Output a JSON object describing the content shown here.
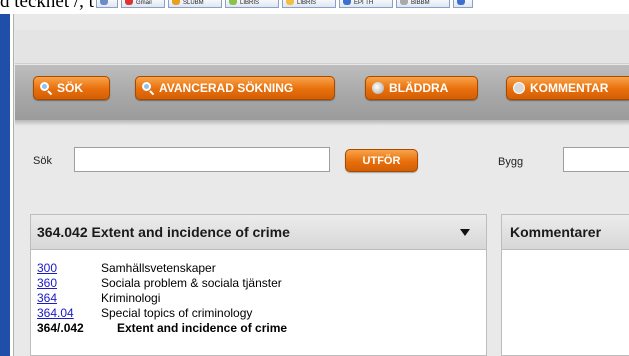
{
  "top_strip": {
    "cut_text": "d tecknet /, t ex",
    "taskbar_items": [
      {
        "label": "",
        "color": "#6b8cc7"
      },
      {
        "label": "Gmail",
        "color": "#d33"
      },
      {
        "label": "SLUBM",
        "color": "#e8a020"
      },
      {
        "label": "LIBRIS",
        "color": "#8bc34a"
      },
      {
        "label": "LIBRIS",
        "color": "#f0c040"
      },
      {
        "label": "EPI TH",
        "color": "#3b6fd0"
      },
      {
        "label": "BIBBM",
        "color": "#aaaaaa"
      },
      {
        "label": "",
        "color": "#3b6fd0"
      }
    ]
  },
  "nav": {
    "buttons": [
      {
        "label": "SÖK",
        "icon": "magnifier-icon"
      },
      {
        "label": "AVANCERAD SÖKNING",
        "icon": "magnifier-icon"
      },
      {
        "label": "BLÄDDRA",
        "icon": "book-icon"
      },
      {
        "label": "KOMMENTAR",
        "icon": "comment-icon"
      }
    ]
  },
  "search": {
    "label": "Sök",
    "value": "",
    "submit_label": "UTFÖR",
    "build_label": "Bygg",
    "build_value": ""
  },
  "hierarchy": {
    "title": "364.042 Extent and incidence of crime",
    "rows": [
      {
        "code": "300",
        "description": "Samhällsvetenskaper",
        "link": true
      },
      {
        "code": "360",
        "description": "Sociala problem & sociala tjänster",
        "link": true
      },
      {
        "code": "364",
        "description": "Kriminologi",
        "link": true
      },
      {
        "code": "364.04",
        "description": "Special topics of criminology",
        "link": true
      },
      {
        "code": "364/.042",
        "description": "Extent and incidence of crime",
        "link": false
      }
    ]
  },
  "comments": {
    "title": "Kommentarer"
  },
  "colors": {
    "accent_orange": "#e86f0b",
    "window_blue": "#1f4fa8",
    "link_blue": "#1a1ac8"
  }
}
